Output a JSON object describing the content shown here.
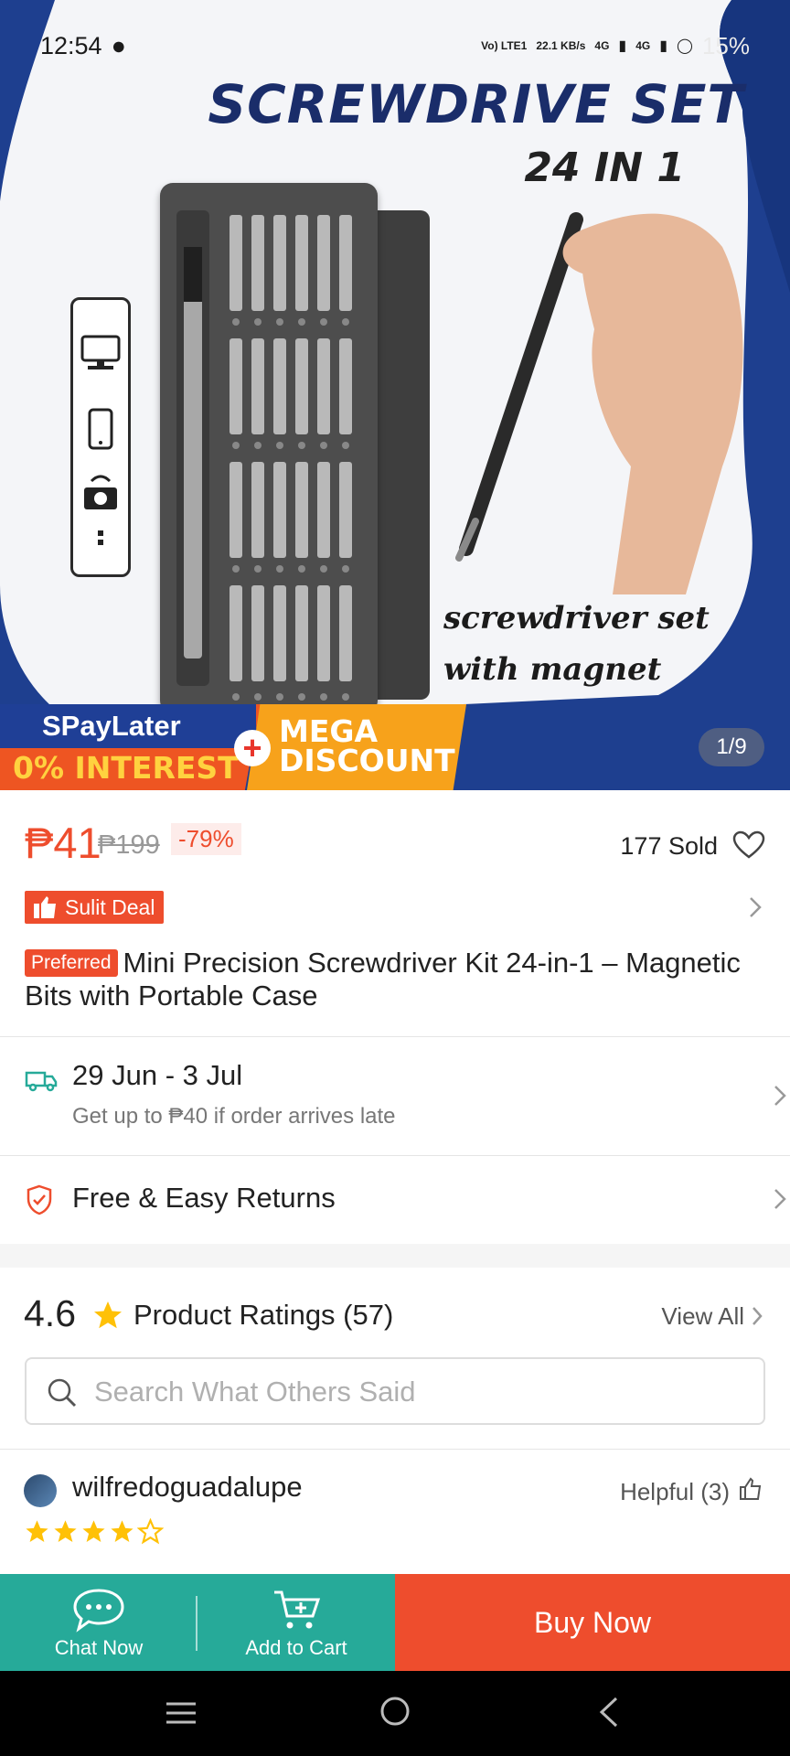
{
  "status_bar": {
    "time": "12:54",
    "volte": "Vo) LTE1",
    "speed": "22.1 KB/s",
    "net1": "4G",
    "net2": "4G",
    "battery": "15%"
  },
  "hero": {
    "headline": "SCREWDRIVE SET",
    "subline": "24 IN 1",
    "caption_line1": "screwdriver set",
    "caption_line2": "with magnet",
    "promo_spay": "SPayLater",
    "promo_interest": "0% INTEREST",
    "promo_mega_line1": "MEGA",
    "promo_mega_line2": "DISCOUNT",
    "image_counter": "1/9"
  },
  "product": {
    "price": "₱41",
    "original_price": "₱199",
    "discount": "-79%",
    "sold": "177 Sold",
    "deal_label": "Sulit Deal",
    "preferred_label": "Preferred",
    "title": "Mini Precision Screwdriver Kit 24-in-1 – Magnetic Bits with Portable Case"
  },
  "shipping": {
    "date": "29 Jun - 3 Jul",
    "guarantee": "Get up to ₱40 if order arrives late"
  },
  "returns": {
    "label": "Free & Easy Returns"
  },
  "ratings": {
    "score": "4.6",
    "label": "Product Ratings (57)",
    "view_all": "View All",
    "search_placeholder": "Search What Others Said"
  },
  "review": {
    "username": "wilfredoguadalupe",
    "helpful": "Helpful (3)",
    "stars": 4,
    "max_stars": 5
  },
  "bottom_bar": {
    "chat_label": "Chat Now",
    "cart_label": "Add to Cart",
    "buy_label": "Buy Now"
  },
  "colors": {
    "accent": "#ee4d2d",
    "teal": "#26aa99",
    "star": "#ffc107"
  }
}
